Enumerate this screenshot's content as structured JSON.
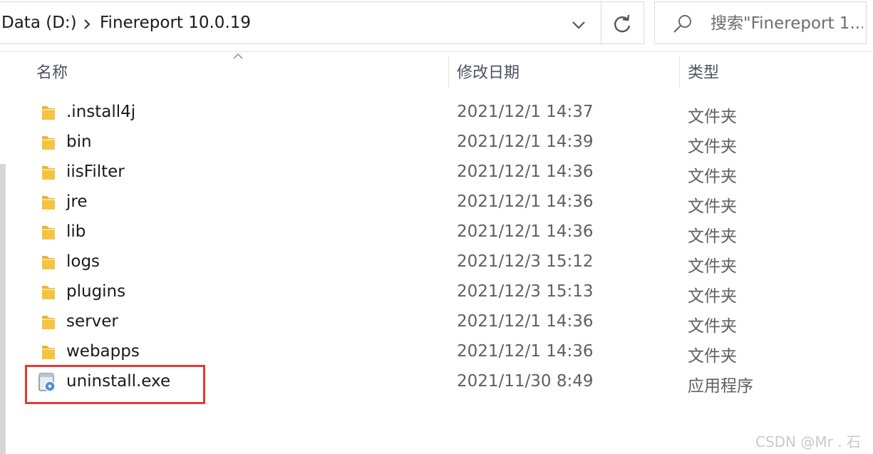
{
  "breadcrumb": {
    "items": [
      "Data (D:)",
      "Finereport 10.0.19"
    ]
  },
  "search": {
    "placeholder": "搜索\"Finereport 1..."
  },
  "columns": {
    "name": "名称",
    "date": "修改日期",
    "type": "类型"
  },
  "files": [
    {
      "name": ".install4j",
      "date": "2021/12/1 14:37",
      "type": "文件夹",
      "icon": "folder-icon"
    },
    {
      "name": "bin",
      "date": "2021/12/1 14:39",
      "type": "文件夹",
      "icon": "folder-icon"
    },
    {
      "name": "iisFilter",
      "date": "2021/12/1 14:36",
      "type": "文件夹",
      "icon": "folder-icon"
    },
    {
      "name": "jre",
      "date": "2021/12/1 14:36",
      "type": "文件夹",
      "icon": "folder-icon"
    },
    {
      "name": "lib",
      "date": "2021/12/1 14:36",
      "type": "文件夹",
      "icon": "folder-icon"
    },
    {
      "name": "logs",
      "date": "2021/12/3 15:12",
      "type": "文件夹",
      "icon": "folder-icon"
    },
    {
      "name": "plugins",
      "date": "2021/12/3 15:13",
      "type": "文件夹",
      "icon": "folder-icon"
    },
    {
      "name": "server",
      "date": "2021/12/1 14:36",
      "type": "文件夹",
      "icon": "folder-icon"
    },
    {
      "name": "webapps",
      "date": "2021/12/1 14:36",
      "type": "文件夹",
      "icon": "folder-icon"
    },
    {
      "name": "uninstall.exe",
      "date": "2021/11/30 8:49",
      "type": "应用程序",
      "icon": "installer-app-icon"
    }
  ],
  "watermark": "CSDN @Mr . 石",
  "colors": {
    "highlight": "#e53935",
    "folder": "#f5c342"
  }
}
